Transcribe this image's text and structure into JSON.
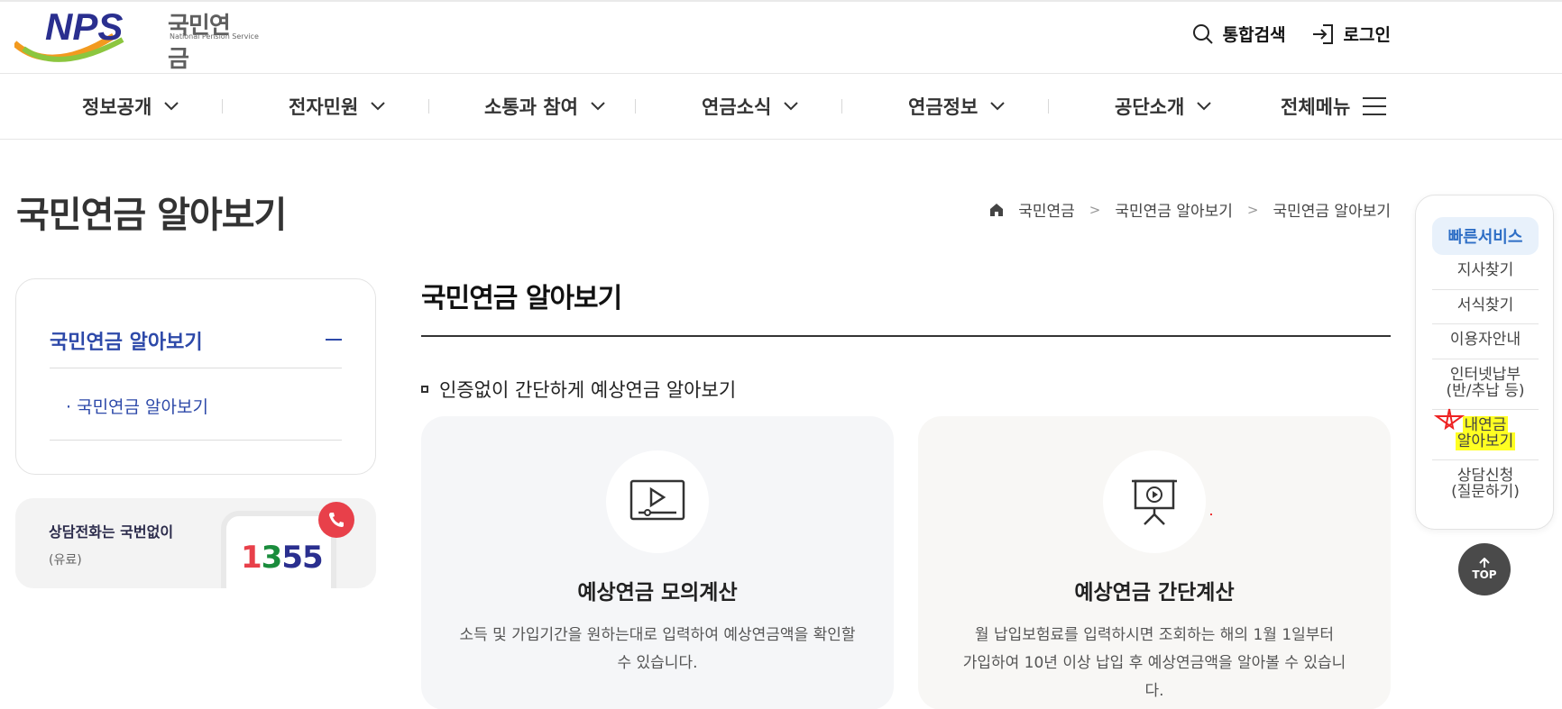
{
  "header": {
    "logo_text_en": "NPS",
    "logo_text_ko": "국민연금",
    "logo_subtext": "National Pension Service",
    "search_label": "통합검색",
    "login_label": "로그인"
  },
  "gnb": {
    "items": [
      {
        "label": "정보공개"
      },
      {
        "label": "전자민원"
      },
      {
        "label": "소통과 참여"
      },
      {
        "label": "연금소식"
      },
      {
        "label": "연금정보"
      },
      {
        "label": "공단소개"
      }
    ],
    "all_menu_label": "전체메뉴"
  },
  "page": {
    "title": "국민연금 알아보기",
    "breadcrumb": [
      "국민연금",
      "국민연금 알아보기",
      "국민연금 알아보기"
    ]
  },
  "lnb": {
    "title": "국민연금 알아보기",
    "sub_items": [
      "국민연금 알아보기"
    ]
  },
  "phone_banner": {
    "title": "상담전화는 국번없이",
    "sub": "(유료)",
    "number": "1355"
  },
  "content": {
    "title": "국민연금 알아보기",
    "section_head": "인증없이 간단하게 예상연금 알아보기",
    "cards": [
      {
        "title": "예상연금 모의계산",
        "desc_line1": "소득 및 가입기간을 원하는대로 입력하여 예상연금액을 확인할",
        "desc_line2": "수 있습니다.",
        "icon": "video-play-icon"
      },
      {
        "title": "예상연금 간단계산",
        "desc_line1": "월 납입보험료를 입력하시면 조회하는 해의 1월 1일부터",
        "desc_line2": "가입하여 10년 이상 납입 후 예상연금액을 알아볼 수 있습니다.",
        "icon": "presentation-play-icon"
      }
    ]
  },
  "quick": {
    "title": "빠른서비스",
    "items": [
      {
        "line1": "지사찾기",
        "line2": ""
      },
      {
        "line1": "서식찾기",
        "line2": ""
      },
      {
        "line1": "이용자안내",
        "line2": ""
      },
      {
        "line1": "인터넷납부",
        "line2": "(반/추납 등)"
      },
      {
        "line1": "내연금",
        "line2": "알아보기"
      },
      {
        "line1": "상담신청",
        "line2": "(질문하기)"
      }
    ],
    "top_label": "TOP"
  },
  "colors": {
    "brand_blue": "#2d49a9",
    "quick_blue": "#2f6fc6",
    "highlight": "#ffff22",
    "call_red": "#e8404a"
  }
}
